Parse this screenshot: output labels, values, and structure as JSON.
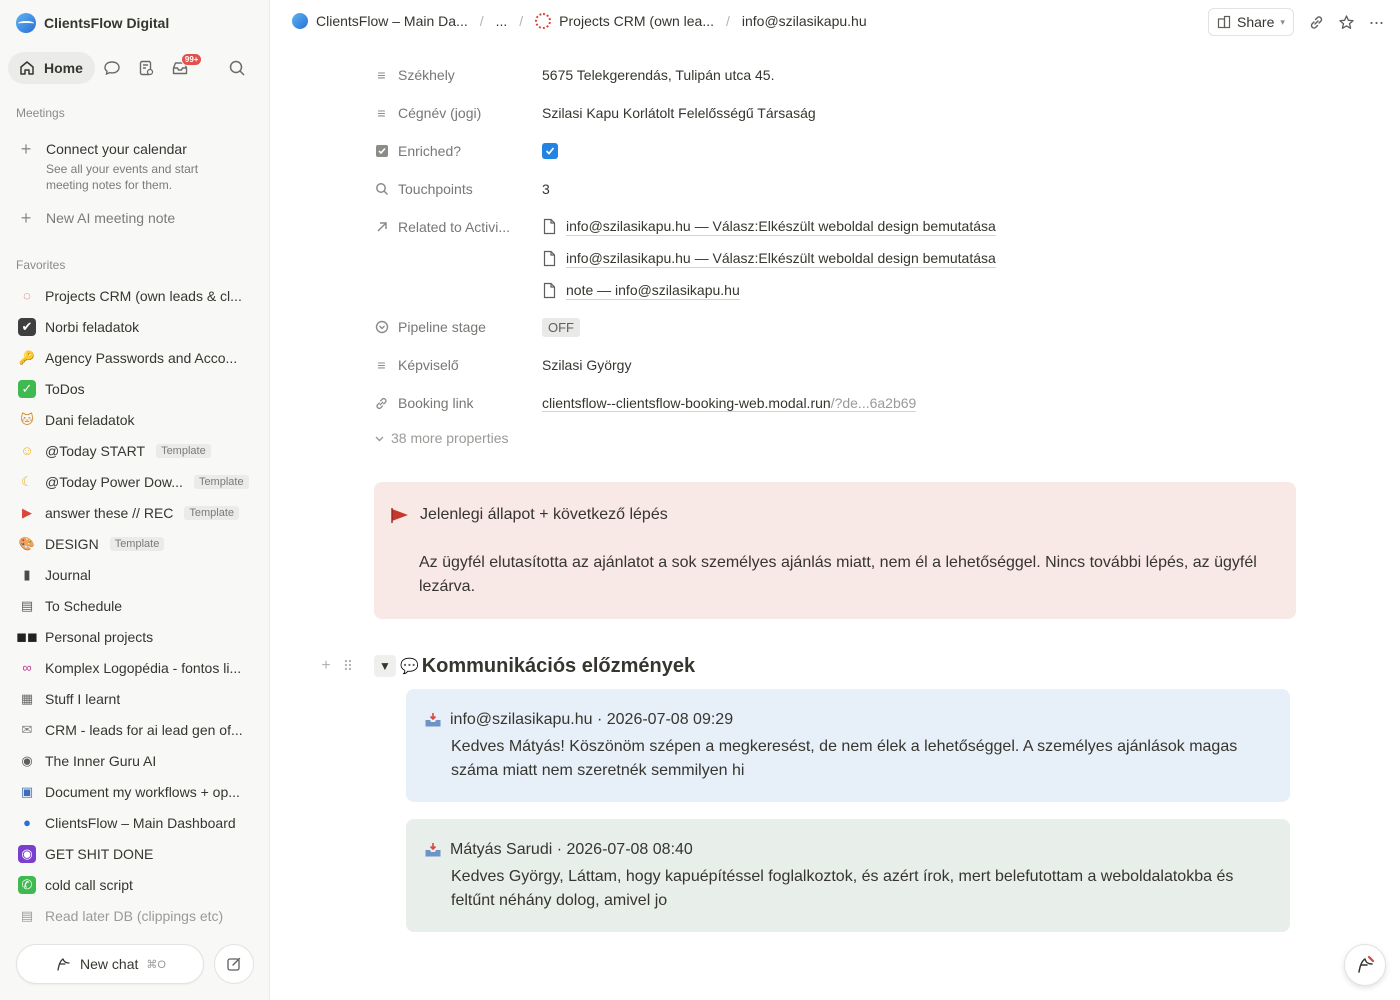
{
  "workspace": {
    "name": "ClientsFlow Digital"
  },
  "sidebar": {
    "home_label": "Home",
    "inbox_badge": "99+",
    "meetings_label": "Meetings",
    "calendar": {
      "title": "Connect your calendar",
      "desc": "See all your events and start meeting notes for them."
    },
    "new_meeting": "New AI meeting note",
    "favorites_label": "Favorites",
    "favorites": [
      {
        "label": "Projects CRM (own leads & cl...",
        "icon": "crm-icon",
        "glyph": "◌",
        "color": "#d9463b"
      },
      {
        "label": "Norbi feladatok",
        "icon": "checkbox-icon",
        "glyph": "✔",
        "color": "#ffffff",
        "bg": "#3f3f3f"
      },
      {
        "label": "Agency Passwords and Acco...",
        "icon": "key-icon",
        "glyph": "🔑",
        "color": "#c9a227"
      },
      {
        "label": "ToDos",
        "icon": "check-icon",
        "glyph": "✓",
        "color": "#ffffff",
        "bg": "#3fb950"
      },
      {
        "label": "Dani feladatok",
        "icon": "cat-icon",
        "glyph": "🐱",
        "color": "#d08a2c"
      },
      {
        "label": "@Today START",
        "icon": "sun-face-icon",
        "glyph": "☺",
        "color": "#f0b429",
        "template": "Template"
      },
      {
        "label": "@Today Power Dow...",
        "icon": "moon-icon",
        "glyph": "☾",
        "color": "#e6b422",
        "template": "Template"
      },
      {
        "label": "answer these // REC",
        "icon": "video-camera-icon",
        "glyph": "▶",
        "color": "#d9463b",
        "template": "Template"
      },
      {
        "label": "DESIGN",
        "icon": "palette-icon",
        "glyph": "🎨",
        "color": "#c9822c",
        "template": "Template"
      },
      {
        "label": "Journal",
        "icon": "notebook-icon",
        "glyph": "▮",
        "color": "#4a4a4a"
      },
      {
        "label": "To Schedule",
        "icon": "calendar-list-icon",
        "glyph": "▤",
        "color": "#5f5e5b"
      },
      {
        "label": "Personal projects",
        "icon": "sunglasses-icon",
        "glyph": "◼◼",
        "color": "#222222"
      },
      {
        "label": "Komplex Logopédia - fontos li...",
        "icon": "link-icon",
        "glyph": "∞",
        "color": "#c0398f"
      },
      {
        "label": "Stuff I learnt",
        "icon": "table-icon",
        "glyph": "▦",
        "color": "#6b6a66"
      },
      {
        "label": "CRM - leads for ai lead gen of...",
        "icon": "inbox-tray-icon",
        "glyph": "✉",
        "color": "#7c7b77"
      },
      {
        "label": "The Inner Guru AI",
        "icon": "robot-icon",
        "glyph": "◉",
        "color": "#5f5e5b"
      },
      {
        "label": "Document my workflows + op...",
        "icon": "chip-icon",
        "glyph": "▣",
        "color": "#3d6fb8"
      },
      {
        "label": "ClientsFlow – Main Dashboard",
        "icon": "clientsflow-logo-icon",
        "glyph": "●",
        "color": "#2a6fd6"
      },
      {
        "label": "GET SHIT DONE",
        "icon": "eye-icon",
        "glyph": "◉",
        "color": "#ffffff",
        "bg": "#7a3fd0"
      },
      {
        "label": "cold call script",
        "icon": "phone-icon",
        "glyph": "✆",
        "color": "#ffffff",
        "bg": "#3fb950"
      },
      {
        "label": "Read later DB (clippings etc)",
        "icon": "document-icon",
        "glyph": "▤",
        "color": "#9b9a97",
        "faded": true
      }
    ],
    "new_chat": "New chat",
    "new_chat_shortcut": "⌘O"
  },
  "topbar": {
    "breadcrumb": [
      "ClientsFlow – Main Da...",
      "...",
      "Projects CRM (own lea...",
      "info@szilasikapu.hu"
    ],
    "share_label": "Share"
  },
  "properties": {
    "szekhely": {
      "label": "Székhely",
      "value": "5675 Telekgerendás, Tulipán utca 45."
    },
    "cegnev": {
      "label": "Cégnév (jogi)",
      "value": "Szilasi Kapu Korlátolt Felelősségű Társaság"
    },
    "enriched": {
      "label": "Enriched?",
      "checked": true
    },
    "touchpoints": {
      "label": "Touchpoints",
      "value": "3"
    },
    "related": {
      "label": "Related to Activi...",
      "items": [
        "info@szilasikapu.hu — Válasz:Elkészült weboldal design bemutatása",
        "info@szilasikapu.hu — Válasz:Elkészült weboldal design bemutatása",
        "note — info@szilasikapu.hu"
      ]
    },
    "pipeline": {
      "label": "Pipeline stage",
      "value": "OFF"
    },
    "kepviselo": {
      "label": "Képviselő",
      "value": "Szilasi György"
    },
    "booking": {
      "label": "Booking link",
      "value_main": "clientsflow--clientsflow-booking-web.modal.run",
      "value_tail": "/?de...6a2b69"
    },
    "more": "38 more properties"
  },
  "callout": {
    "title": "Jelenlegi állapot + következő lépés",
    "body": "Az ügyfél elutasította az ajánlatot a sok személyes ajánlás miatt, nem él a lehetőséggel. Nincs további lépés, az ügyfél lezárva.",
    "bg": "#f8e8e6"
  },
  "history": {
    "title": "Kommunikációs előzmények",
    "messages": [
      {
        "header": "info@szilasikapu.hu · 2026-07-08 09:29",
        "body": "Kedves Mátyás! Köszönöm szépen a megkeresést, de nem élek a lehetőséggel. A személyes ajánlások magas száma miatt nem szeretnék semmilyen hi",
        "bg": "#e7f0f8"
      },
      {
        "header": "Mátyás Sarudi · 2026-07-08 08:40",
        "body": "Kedves György, Láttam, hogy kapuépítéssel foglalkoztok, és azért írok, mert belefutottam a weboldalatokba és feltűnt néhány dolog, amivel jo",
        "bg": "#e8eeea"
      }
    ]
  }
}
